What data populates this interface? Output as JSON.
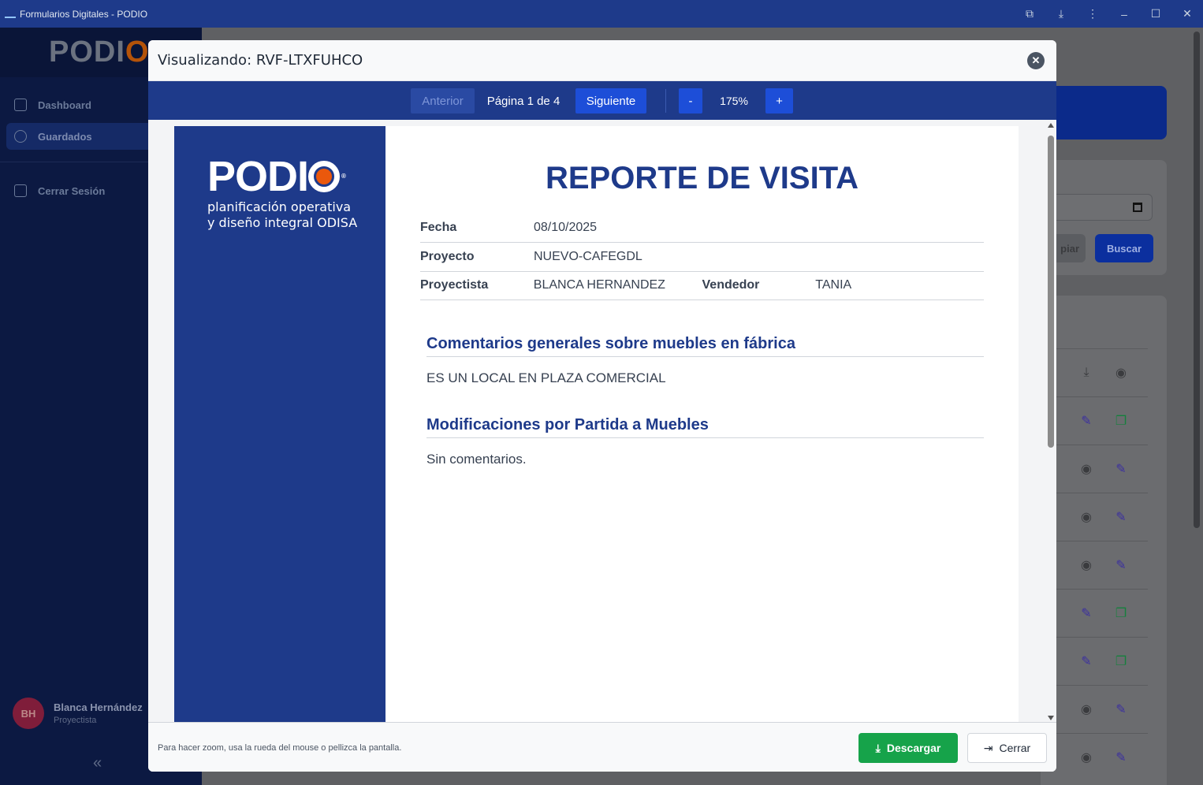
{
  "window": {
    "title": "Formularios Digitales - PODIO",
    "controls": [
      "puzzle-icon",
      "download-icon",
      "more-icon",
      "minimize-icon",
      "maximize-icon",
      "close-icon"
    ]
  },
  "sidebar": {
    "logo": "PODIO",
    "items": [
      {
        "label": "Dashboard",
        "icon": "grid-icon"
      },
      {
        "label": "Guardados",
        "icon": "clock-icon"
      },
      {
        "label": "Cerrar Sesión",
        "icon": "logout-icon"
      }
    ],
    "user": {
      "initials": "BH",
      "name": "Blanca Hernández",
      "role": "Proyectista"
    }
  },
  "background": {
    "limpiar_label": "piar",
    "buscar_label": "Buscar"
  },
  "modal": {
    "title": "Visualizando: RVF-LTXFUHCO",
    "toolbar": {
      "prev": "Anterior",
      "page": "Página 1 de 4",
      "next": "Siguiente",
      "minus": "-",
      "zoom": "175%",
      "plus": "+"
    },
    "footer": {
      "hint": "Para hacer zoom, usa la rueda del mouse o pellizca la pantalla.",
      "download": "Descargar",
      "close": "Cerrar"
    }
  },
  "document": {
    "brand": {
      "name": "PODI",
      "tagline_1": "planificación operativa",
      "tagline_2": "y diseño integral ODISA"
    },
    "title": "REPORTE DE VISITA",
    "fields": {
      "fecha_label": "Fecha",
      "fecha": "08/10/2025",
      "proyecto_label": "Proyecto",
      "proyecto": "NUEVO-CAFEGDL",
      "proyectista_label": "Proyectista",
      "proyectista": "BLANCA HERNANDEZ",
      "vendedor_label": "Vendedor",
      "vendedor": "TANIA"
    },
    "sections": [
      {
        "heading": "Comentarios generales sobre muebles en fábrica",
        "text": "ES UN LOCAL EN PLAZA COMERCIAL"
      },
      {
        "heading": "Modificaciones por Partida a Muebles",
        "text": "Sin comentarios."
      }
    ]
  },
  "colors": {
    "primary": "#1e3a8a",
    "accent": "#1d4ed8",
    "success": "#16a34a",
    "brand_orange": "#ea580c"
  }
}
